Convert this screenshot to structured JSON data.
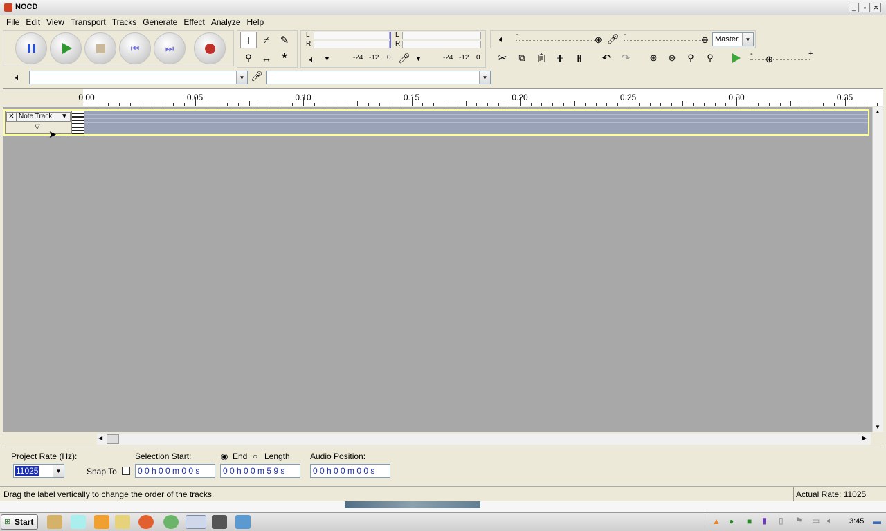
{
  "window": {
    "title": "NOCD",
    "minimize": "_",
    "restore": "▫",
    "close": "✕"
  },
  "menu": [
    "File",
    "Edit",
    "View",
    "Transport",
    "Tracks",
    "Generate",
    "Effect",
    "Analyze",
    "Help"
  ],
  "meters": {
    "play_scale": [
      "-24",
      "-12",
      "0"
    ],
    "rec_scale": [
      "-24",
      "-12",
      "0"
    ],
    "channel_l": "L",
    "channel_r": "R"
  },
  "mixer": {
    "minus": "-",
    "plus": "+",
    "input_source": "Master"
  },
  "device": {
    "output_device": "",
    "input_device": ""
  },
  "ruler": {
    "ticks": [
      "0.00",
      "0.05",
      "0.10",
      "0.15",
      "0.20",
      "0.25",
      "0.30",
      "0.35"
    ]
  },
  "track": {
    "name": "Note Track"
  },
  "selection": {
    "project_rate_label": "Project Rate (Hz):",
    "project_rate_value": "11025",
    "snap_to_label": "Snap To",
    "selection_start_label": "Selection Start:",
    "end_label": "End",
    "length_label": "Length",
    "audio_position_label": "Audio Position:",
    "start_time": "0 0 h 0 0 m 0 0 s",
    "end_time": "0 0 h 0 0 m 5 9 s",
    "audio_position": "0 0 h 0 0 m 0 0 s"
  },
  "status": {
    "message": "Drag the label vertically to change the order of the tracks.",
    "actual_rate": "Actual Rate: 11025"
  },
  "taskbar": {
    "start_label": "Start",
    "clock": "3:45"
  },
  "colors": {
    "accent_blue": "#1b2fb0",
    "record_red": "#c0302a",
    "play_green": "#2e9a2e"
  }
}
